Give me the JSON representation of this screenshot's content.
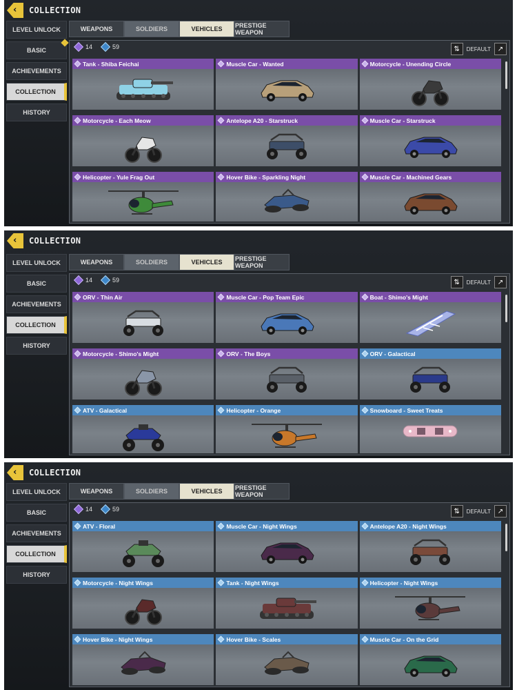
{
  "panels": [
    {
      "title": "COLLECTION",
      "sidebar": [
        "LEVEL UNLOCK",
        "BASIC",
        "ACHIEVEMENTS",
        "COLLECTION",
        "HISTORY"
      ],
      "tabs": [
        "WEAPONS",
        "SOLDIERS",
        "VEHICLES",
        "PRESTIGE WEAPON"
      ],
      "stats": {
        "purple": "14",
        "blue": "59"
      },
      "sort_label": "DEFAULT",
      "cards": [
        {
          "label": "Tank - Shiba Feichai",
          "rarity": "epic",
          "icon": "tank-icon",
          "color": "#8fd2e6"
        },
        {
          "label": "Muscle Car - Wanted",
          "rarity": "epic",
          "icon": "car-icon",
          "color": "#b8a07a"
        },
        {
          "label": "Motorcycle - Unending Circle",
          "rarity": "epic",
          "icon": "motorcycle-icon",
          "color": "#3a3a3a"
        },
        {
          "label": "Motorcycle - Each Meow",
          "rarity": "epic",
          "icon": "motorcycle-icon",
          "color": "#e6e6e6"
        },
        {
          "label": "Antelope A20 - Starstruck",
          "rarity": "epic",
          "icon": "buggy-icon",
          "color": "#3d4e68"
        },
        {
          "label": "Muscle Car - Starstruck",
          "rarity": "epic",
          "icon": "car-icon",
          "color": "#3b4aa8"
        },
        {
          "label": "Helicopter - Yule Frag Out",
          "rarity": "epic",
          "icon": "helicopter-icon",
          "color": "#3e8a3a"
        },
        {
          "label": "Hover Bike - Sparkling Night",
          "rarity": "epic",
          "icon": "hoverbike-icon",
          "color": "#3a5a8a"
        },
        {
          "label": "Muscle Car - Machined Gears",
          "rarity": "epic",
          "icon": "car-icon",
          "color": "#7a4a30"
        }
      ]
    },
    {
      "title": "COLLECTION",
      "sidebar": [
        "LEVEL UNLOCK",
        "BASIC",
        "ACHIEVEMENTS",
        "COLLECTION",
        "HISTORY"
      ],
      "tabs": [
        "WEAPONS",
        "SOLDIERS",
        "VEHICLES",
        "PRESTIGE WEAPON"
      ],
      "stats": {
        "purple": "14",
        "blue": "59"
      },
      "sort_label": "DEFAULT",
      "cards": [
        {
          "label": "ORV - Thin Air",
          "rarity": "epic",
          "icon": "buggy-icon",
          "color": "#d8dde2"
        },
        {
          "label": "Muscle Car - Pop Team Epic",
          "rarity": "epic",
          "icon": "car-icon",
          "color": "#4a78b8"
        },
        {
          "label": "Boat - Shimo's Might",
          "rarity": "epic",
          "icon": "boat-icon",
          "color": "#a8b4e8"
        },
        {
          "label": "Motorcycle - Shimo's Might",
          "rarity": "epic",
          "icon": "motorcycle-icon",
          "color": "#8a96a8"
        },
        {
          "label": "ORV - The Boys",
          "rarity": "epic",
          "icon": "buggy-icon",
          "color": "#5a6068"
        },
        {
          "label": "ORV - Galactical",
          "rarity": "rare",
          "icon": "buggy-icon",
          "color": "#2a3a8a"
        },
        {
          "label": "ATV - Galactical",
          "rarity": "rare",
          "icon": "atv-icon",
          "color": "#2a3a9a"
        },
        {
          "label": "Helicopter - Orange",
          "rarity": "rare",
          "icon": "helicopter-icon",
          "color": "#c8782a"
        },
        {
          "label": "Snowboard  - Sweet Treats",
          "rarity": "rare",
          "icon": "snowboard-icon",
          "color": "#e8b8c8"
        }
      ]
    },
    {
      "title": "COLLECTION",
      "sidebar": [
        "LEVEL UNLOCK",
        "BASIC",
        "ACHIEVEMENTS",
        "COLLECTION",
        "HISTORY"
      ],
      "tabs": [
        "WEAPONS",
        "SOLDIERS",
        "VEHICLES",
        "PRESTIGE WEAPON"
      ],
      "stats": {
        "purple": "14",
        "blue": "59"
      },
      "sort_label": "DEFAULT",
      "cards": [
        {
          "label": "ATV - Floral",
          "rarity": "rare",
          "icon": "atv-icon",
          "color": "#5a8a5a"
        },
        {
          "label": "Muscle Car - Night Wings",
          "rarity": "rare",
          "icon": "car-icon",
          "color": "#4a2a4a"
        },
        {
          "label": "Antelope A20 - Night Wings",
          "rarity": "rare",
          "icon": "buggy-icon",
          "color": "#7a4a3a"
        },
        {
          "label": "Motorcycle - Night Wings",
          "rarity": "rare",
          "icon": "motorcycle-icon",
          "color": "#5a2a2a"
        },
        {
          "label": "Tank - Night Wings",
          "rarity": "rare",
          "icon": "tank-icon",
          "color": "#6a3a3a"
        },
        {
          "label": "Helicopter - Night Wings",
          "rarity": "rare",
          "icon": "helicopter-icon",
          "color": "#5a3a3a"
        },
        {
          "label": "Hover Bike - Night Wings",
          "rarity": "rare",
          "icon": "hoverbike-icon",
          "color": "#4a2a4a"
        },
        {
          "label": "Hover Bike - Scales",
          "rarity": "rare",
          "icon": "hoverbike-icon",
          "color": "#6a5a4a"
        },
        {
          "label": "Muscle Car - On the Grid",
          "rarity": "rare",
          "icon": "car-icon",
          "color": "#2a6a4a"
        }
      ]
    }
  ]
}
